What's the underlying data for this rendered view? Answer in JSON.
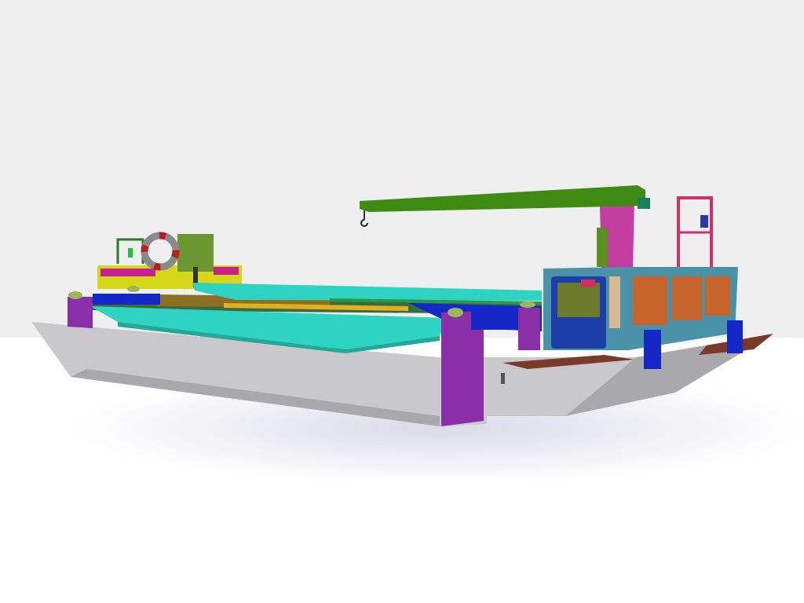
{
  "scene": {
    "subject": "workboat-render",
    "colors": {
      "background_top": "#efefef",
      "background_bottom": "#ffffff",
      "floor_shadow": "#d6d6e6",
      "hull_side": "#c9c9cb",
      "hull_shadow": "#a9a9ad",
      "deck_panel": "#2fd3c3",
      "deck_panel_dark": "#21a99c",
      "crane_boom": "#3f8a12",
      "crane_post": "#c23fa0",
      "bollard": "#8b2fa8",
      "cabin": "#4a92a8",
      "cabin_door": "#1d3ea8",
      "cabin_window": "#c7642b",
      "cabin_rail": "#d0306a",
      "stern_deck": "#7a3a2a",
      "lifebuoy": "#8a8a8a",
      "lifebuoy_stripe": "#b82020",
      "fender_blue": "#1428c8",
      "railing_yellow": "#d6d61a",
      "console_green": "#6b9630",
      "rope": "#9ab85a"
    }
  }
}
